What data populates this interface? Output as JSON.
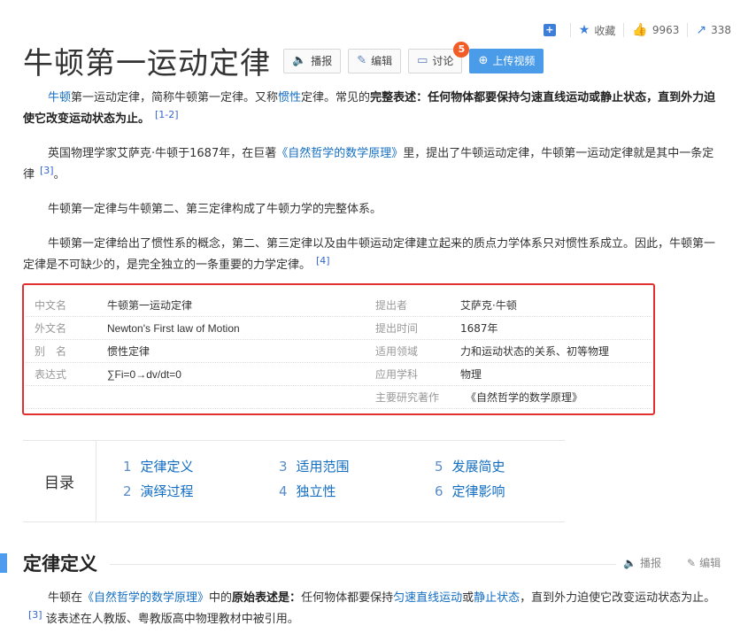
{
  "stats": {
    "favorite_label": "收藏",
    "likes": "9963",
    "shares": "338"
  },
  "title": "牛顿第一运动定律",
  "toolbar": {
    "broadcast": "播报",
    "edit": "编辑",
    "discuss": "讨论",
    "discuss_badge": "5",
    "upload": "上传视频"
  },
  "paragraphs": {
    "p1": {
      "link1": "牛顿",
      "t1": "第一运动定律，简称牛顿第一定律。又称",
      "link2": "惯性",
      "t2": "定律。常见的",
      "b1": "完整表述：任何物体都要保持匀速直线运动或静止状态，直到外力迫使它改变运动状态为止。",
      "ref": "[1-2]"
    },
    "p2": {
      "t1": "英国物理学家艾萨克·牛顿于1687年，在巨著",
      "link": "《自然哲学的数学原理》",
      "t2": "里，提出了牛顿运动定律，牛顿第一运动定律就是其中一条定律",
      "ref": "[3]",
      "t3": "。"
    },
    "p3": "牛顿第一定律与牛顿第二、第三定律构成了牛顿力学的完整体系。",
    "p4": {
      "t1": "牛顿第一定律给出了惯性系的概念，第二、第三定律以及由牛顿运动定律建立起来的质点力学体系只对惯性系成立。因此，牛顿第一定律是不可缺少的，是完全独立的一条重要的力学定律。",
      "ref": "[4]"
    }
  },
  "infobox": {
    "rows": [
      {
        "label": "中文名",
        "value": "牛顿第一运动定律",
        "label2": "提出者",
        "value2": "艾萨克·牛顿"
      },
      {
        "label": "外文名",
        "value": "Newton's First law of Motion",
        "label2": "提出时间",
        "value2": "1687年"
      },
      {
        "label": "别　名",
        "value": "惯性定律",
        "label2": "适用领域",
        "value2": "力和运动状态的关系、初等物理"
      },
      {
        "label": "表达式",
        "value": "∑Fi=0→dv/dt=0",
        "label2": "应用学科",
        "value2": "物理"
      },
      {
        "label": "",
        "value": "",
        "label2": "主要研究著作",
        "value2": "《自然哲学的数学原理》"
      }
    ]
  },
  "catalog": {
    "title": "目录",
    "items": [
      {
        "num": "1",
        "label": "定律定义"
      },
      {
        "num": "2",
        "label": "演绎过程"
      },
      {
        "num": "3",
        "label": "适用范围"
      },
      {
        "num": "4",
        "label": "独立性"
      },
      {
        "num": "5",
        "label": "发展简史"
      },
      {
        "num": "6",
        "label": "定律影响"
      }
    ]
  },
  "section": {
    "title": "定律定义",
    "broadcast": "播报",
    "edit": "编辑"
  },
  "p5": {
    "t1": "牛顿在",
    "link1": "《自然哲学的数学原理》",
    "t2": "中的",
    "b1": "原始表述是：",
    "t3": "任何物体都要保持",
    "link2": "匀速直线运动",
    "t4": "或",
    "link3": "静止状态",
    "t5": "，直到外力迫使它改变运动状态为止。",
    "ref": "[3]",
    "t6": "该表述在人教版、粤教版高中物理教材中被引用。"
  }
}
